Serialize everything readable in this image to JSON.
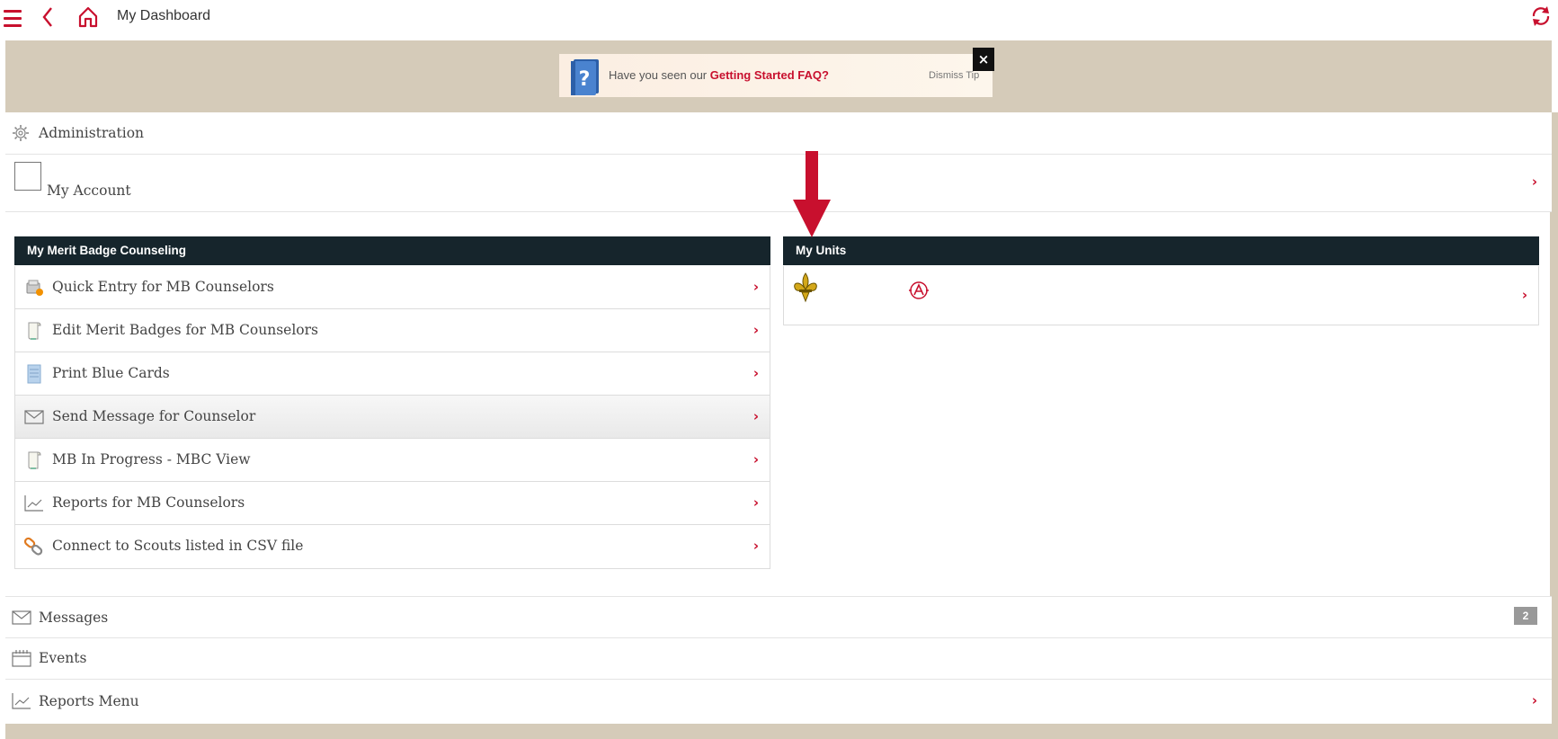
{
  "topbar": {
    "title": "My Dashboard"
  },
  "tip": {
    "text_prefix": "Have you seen our ",
    "link_text": "Getting Started FAQ?",
    "dismiss": "Dismiss Tip",
    "close": "×"
  },
  "sections": {
    "administration": "Administration",
    "my_account": "My Account",
    "messages": "Messages",
    "messages_count": "2",
    "events": "Events",
    "reports_menu": "Reports Menu"
  },
  "mb_panel": {
    "title": "My Merit Badge Counseling",
    "items": [
      {
        "label": "Quick Entry for MB Counselors",
        "icon": "quick-entry-icon"
      },
      {
        "label": "Edit Merit Badges for MB Counselors",
        "icon": "scroll-icon"
      },
      {
        "label": "Print Blue Cards",
        "icon": "blue-card-icon"
      },
      {
        "label": "Send Message for Counselor",
        "icon": "envelope-icon"
      },
      {
        "label": "MB In Progress - MBC View",
        "icon": "scroll-icon"
      },
      {
        "label": "Reports for MB Counselors",
        "icon": "chart-line-icon"
      },
      {
        "label": "Connect to Scouts listed in CSV file",
        "icon": "chain-link-icon"
      }
    ]
  },
  "units_panel": {
    "title": "My Units"
  },
  "colors": {
    "accent": "#c8102e",
    "band": "#d5cbb9",
    "panel_header": "#16252c"
  }
}
